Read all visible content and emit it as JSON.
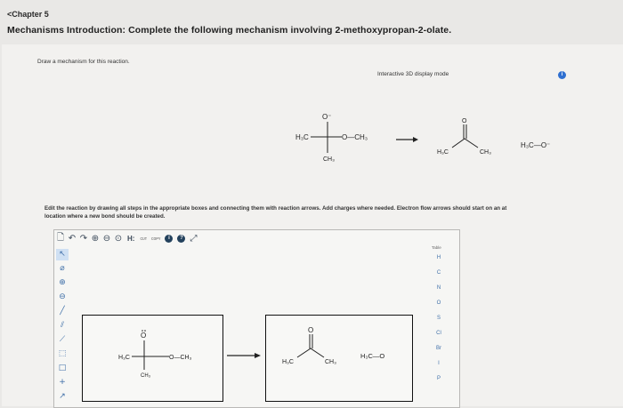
{
  "nav": {
    "back_label": "<Chapter 5"
  },
  "header": {
    "title": "Mechanisms Introduction: Complete the following mechanism involving 2-methoxypropan-2-olate."
  },
  "question": {
    "prompt": "Draw a mechanism for this reaction.",
    "mode_label": "Interactive 3D display mode",
    "info_icon": "i",
    "instructions": "Edit the reaction by drawing all steps in the appropriate boxes and connecting them with reaction arrows. Add charges where needed. Electron flow arrows should start on an at\nlocation where a new bond should be created."
  },
  "reaction": {
    "reactant": {
      "left": "H₃C",
      "right": "O—CH₃",
      "top": "O⁻",
      "bottom": "CH₃"
    },
    "product1": {
      "top": "O",
      "left": "H₃C",
      "right": "CH₃"
    },
    "product2": "H₃C—O⁻"
  },
  "editor": {
    "toolbar": {
      "new_icon": "🗋",
      "undo_icon": "↶",
      "redo_icon": "↷",
      "zoom_in_icon": "⊕",
      "zoom_out_icon": "⊖",
      "zoom_fit_icon": "⊙",
      "h_label": "H:",
      "small1": "ᴄᴜᴛ",
      "small2": "ᴄᴏᴘʏ",
      "info_icon": "i",
      "help_icon": "?",
      "expand_icon": "⤢"
    },
    "left_tools": [
      "↖",
      "⌀",
      "⊕",
      "⊖",
      "╱",
      "⫽",
      "⟋",
      "⬚",
      "□",
      "+",
      "↗"
    ],
    "periodic_label": "Table",
    "elements": [
      "H",
      "C",
      "N",
      "O",
      "S",
      "Cl",
      "Br",
      "I",
      "P"
    ],
    "box1": {
      "top": "O",
      "left": "H₃C",
      "right": "O—CH₃",
      "bottom": "CH₃"
    },
    "box2": {
      "top": "O",
      "left": "H₃C",
      "right": "CH₃",
      "ion": "H₃C—O"
    }
  }
}
